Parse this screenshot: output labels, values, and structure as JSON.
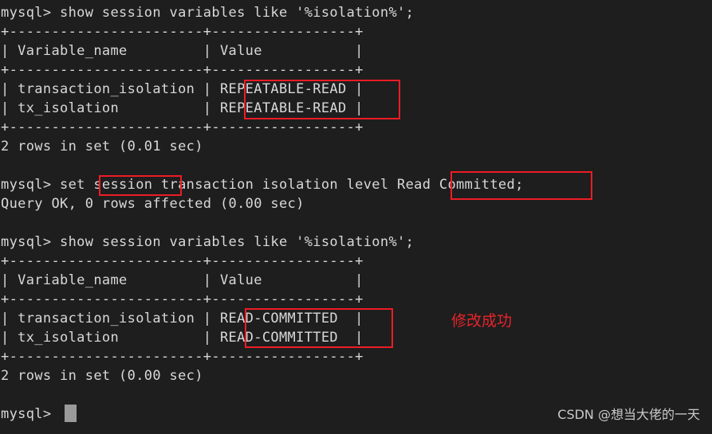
{
  "terminal": {
    "background_color": "#1e1e1e",
    "text_color": "#d8d8d8",
    "prompt": "mysql>",
    "lines": [
      "mysql> show session variables like '%isolation%';",
      "+-----------------------+-----------------+",
      "| Variable_name         | Value           |",
      "+-----------------------+-----------------+",
      "| transaction_isolation | REPEATABLE-READ |",
      "| tx_isolation          | REPEATABLE-READ |",
      "+-----------------------+-----------------+",
      "2 rows in set (0.01 sec)",
      "",
      "mysql> set session transaction isolation level Read Committed;",
      "Query OK, 0 rows affected (0.00 sec)",
      "",
      "mysql> show session variables like '%isolation%';",
      "+-----------------------+-----------------+",
      "| Variable_name         | Value           |",
      "+-----------------------+-----------------+",
      "| transaction_isolation | READ-COMMITTED  |",
      "| tx_isolation          | READ-COMMITTED  |",
      "+-----------------------+-----------------+",
      "2 rows in set (0.00 sec)",
      "",
      "mysql> "
    ],
    "commands": {
      "show_isolation": "show session variables like '%isolation%';",
      "set_isolation": "set session transaction isolation level Read Committed;",
      "query_ok": "Query OK, 0 rows affected (0.00 sec)",
      "rows_first": "2 rows in set (0.01 sec)",
      "rows_second": "2 rows in set (0.00 sec)"
    },
    "table_first": {
      "headers": [
        "Variable_name",
        "Value"
      ],
      "rows": [
        [
          "transaction_isolation",
          "REPEATABLE-READ"
        ],
        [
          "tx_isolation",
          "REPEATABLE-READ"
        ]
      ],
      "row_count_text": "2 rows in set (0.01 sec)"
    },
    "table_second": {
      "headers": [
        "Variable_name",
        "Value"
      ],
      "rows": [
        [
          "transaction_isolation",
          "READ-COMMITTED"
        ],
        [
          "tx_isolation",
          "READ-COMMITTED"
        ]
      ],
      "row_count_text": "2 rows in set (0.00 sec)"
    }
  },
  "annotations": {
    "color": "#ee1c25",
    "success_note": "修改成功",
    "highlight_labels": {
      "repeatable_read": "REPEATABLE-READ",
      "session_keyword": "session",
      "read_committed_command": "Read Committed;",
      "read_committed_value": "READ-COMMITTED"
    }
  },
  "watermark": {
    "text": "CSDN @想当大佬的一天",
    "color": "#c9c9c9"
  }
}
